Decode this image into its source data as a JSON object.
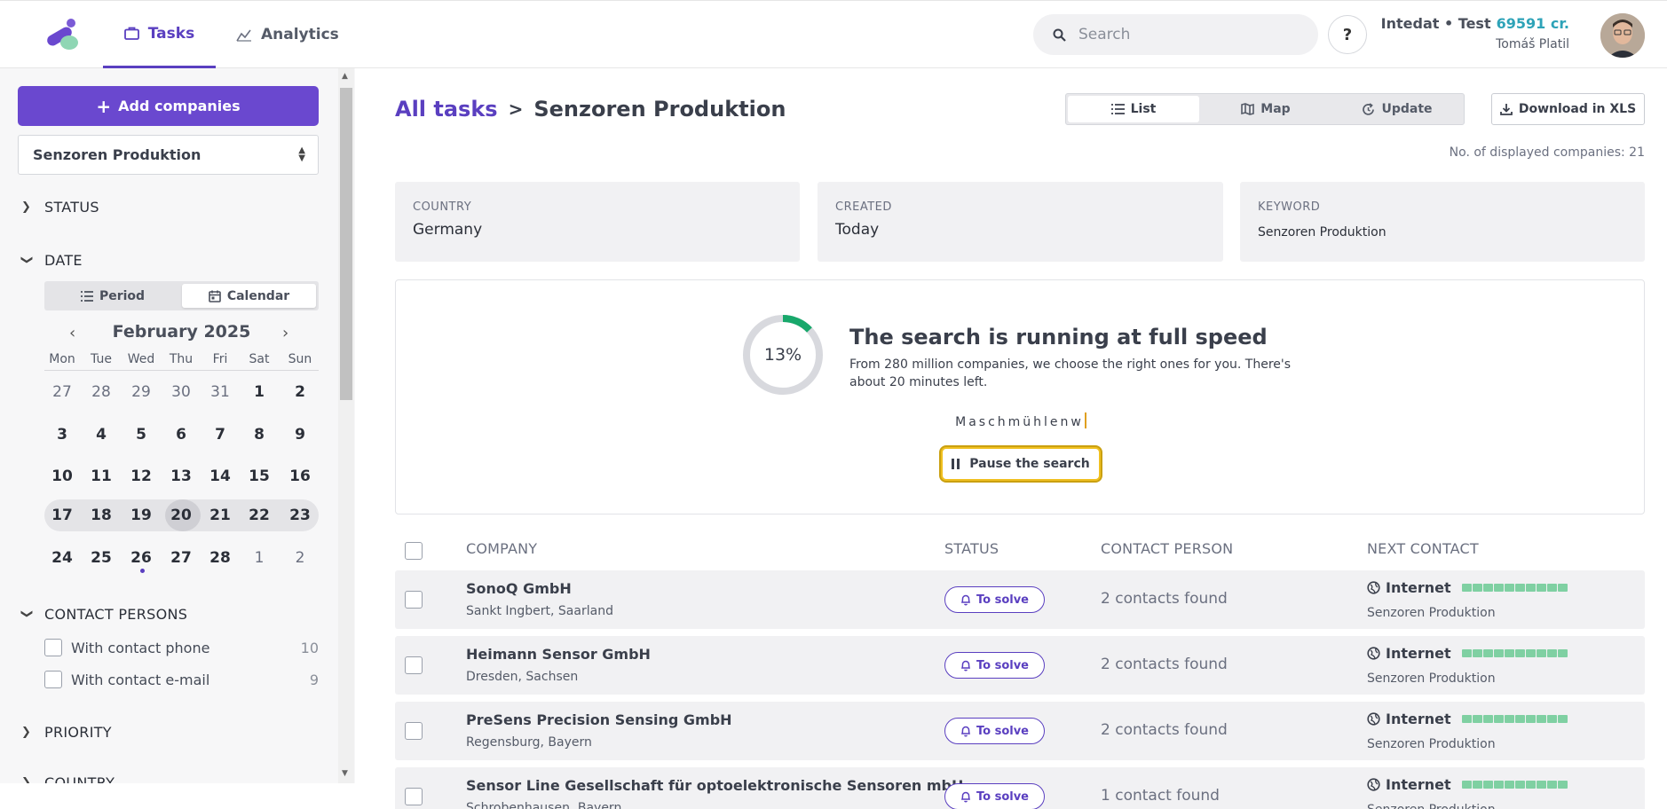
{
  "nav": {
    "tabs": [
      {
        "label": "Tasks",
        "icon": "briefcase-icon",
        "active": true
      },
      {
        "label": "Analytics",
        "icon": "analytics-icon",
        "active": false
      }
    ]
  },
  "header": {
    "search_placeholder": "Search",
    "help_label": "?",
    "org": "Intedat • Test",
    "credits": "69591 cr.",
    "user": "Tomáš Platil"
  },
  "sidebar": {
    "add_button": "Add companies",
    "task_select": "Senzoren Produktion",
    "sections": {
      "status": "STATUS",
      "date": "DATE",
      "contact_persons": "CONTACT PERSONS",
      "priority": "PRIORITY",
      "country": "COUNTRY"
    },
    "date_mode": {
      "period": "Period",
      "calendar": "Calendar"
    },
    "calendar": {
      "month": "February 2025",
      "weekdays": [
        "Mon",
        "Tue",
        "Wed",
        "Thu",
        "Fri",
        "Sat",
        "Sun"
      ],
      "weeks": [
        [
          "27",
          "28",
          "29",
          "30",
          "31",
          "1",
          "2"
        ],
        [
          "3",
          "4",
          "5",
          "6",
          "7",
          "8",
          "9"
        ],
        [
          "10",
          "11",
          "12",
          "13",
          "14",
          "15",
          "16"
        ],
        [
          "17",
          "18",
          "19",
          "20",
          "21",
          "22",
          "23"
        ],
        [
          "24",
          "25",
          "26",
          "27",
          "28",
          "1",
          "2"
        ]
      ],
      "today": "20"
    },
    "contact_filters": [
      {
        "label": "With contact phone",
        "count": "10"
      },
      {
        "label": "With contact e-mail",
        "count": "9"
      }
    ]
  },
  "main": {
    "breadcrumb": {
      "root": "All tasks",
      "separator": ">",
      "current": "Senzoren Produktion"
    },
    "views": {
      "list": "List",
      "map": "Map",
      "update": "Update"
    },
    "download": "Download in XLS",
    "displayed": "No. of displayed companies: 21",
    "info": [
      {
        "label": "COUNTRY",
        "value": "Germany"
      },
      {
        "label": "CREATED",
        "value": "Today"
      },
      {
        "label": "KEYWORD",
        "value": "Senzoren Produktion"
      }
    ],
    "progress": {
      "percent_label": "13%",
      "percent": 13,
      "title": "The search is running at full speed",
      "description": "From 280 million companies, we choose the right ones for you. There's about 20 minutes left.",
      "typing": "Maschmühlenw",
      "pause": "Pause the search"
    },
    "table": {
      "headers": {
        "company": "COMPANY",
        "status": "STATUS",
        "contact": "CONTACT PERSON",
        "next": "NEXT CONTACT"
      },
      "rows": [
        {
          "company": "SonoQ GmbH",
          "place": "Sankt Ingbert, Saarland",
          "status": "To solve",
          "contacts": "2 contacts found",
          "next": "Internet",
          "next_sub": "Senzoren Produktion"
        },
        {
          "company": "Heimann Sensor GmbH",
          "place": "Dresden, Sachsen",
          "status": "To solve",
          "contacts": "2 contacts found",
          "next": "Internet",
          "next_sub": "Senzoren Produktion"
        },
        {
          "company": "PreSens Precision Sensing GmbH",
          "place": "Regensburg, Bayern",
          "status": "To solve",
          "contacts": "2 contacts found",
          "next": "Internet",
          "next_sub": "Senzoren Produktion"
        },
        {
          "company": "Sensor Line Gesellschaft für optoelektronische Sensoren mbH",
          "place": "Schrobenhausen, Bayern",
          "status": "To solve",
          "contacts": "1 contact found",
          "next": "Internet",
          "next_sub": "Senzoren Produktion"
        }
      ]
    }
  },
  "colors": {
    "accent": "#5a3fc0",
    "button": "#6a48cf",
    "credits": "#2ea3b8",
    "progress": "#18a86b",
    "bar": "#7fd0a2"
  }
}
